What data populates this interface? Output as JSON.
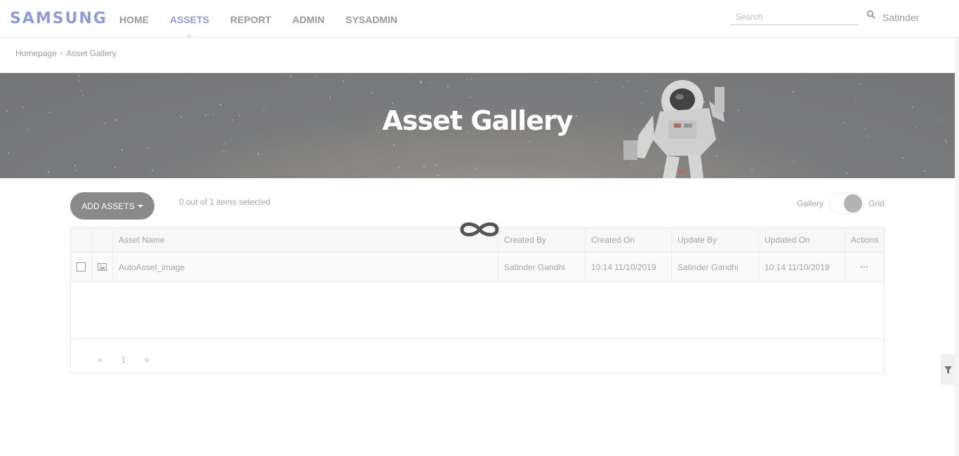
{
  "brand": {
    "logo_text": "SAMSUNG",
    "logo_color": "#8e9cd0"
  },
  "nav": {
    "items": [
      {
        "label": "HOME",
        "active": false
      },
      {
        "label": "ASSETS",
        "active": true
      },
      {
        "label": "REPORT",
        "active": false
      },
      {
        "label": "ADMIN",
        "active": false
      },
      {
        "label": "SYSADMIN",
        "active": false
      }
    ]
  },
  "search": {
    "placeholder": "Search",
    "value": "",
    "icon": "search-icon"
  },
  "user": {
    "name": "Satinder"
  },
  "breadcrumb": {
    "items": [
      "Homepage",
      "Asset Gallery"
    ]
  },
  "hero": {
    "title": "Asset Gallery"
  },
  "toolbar": {
    "add_label": "ADD ASSETS",
    "selected_text": "0 out of 1 items selected",
    "view_left": "Gallery",
    "view_right": "Grid"
  },
  "table": {
    "headers": [
      "Asset Name",
      "Created By",
      "Created On",
      "Update By",
      "Updated On",
      "Actions"
    ],
    "rows": [
      {
        "asset_name": "AutoAsset_image",
        "created_by": "Satinder Gandhi",
        "created_on": "10:14 11/10/2019",
        "update_by": "Satinder Gandhi",
        "updated_on": "10:14 11/10/2019",
        "actions": "•••"
      }
    ]
  },
  "pager": {
    "prev": "«",
    "page": "1",
    "next": "»"
  }
}
